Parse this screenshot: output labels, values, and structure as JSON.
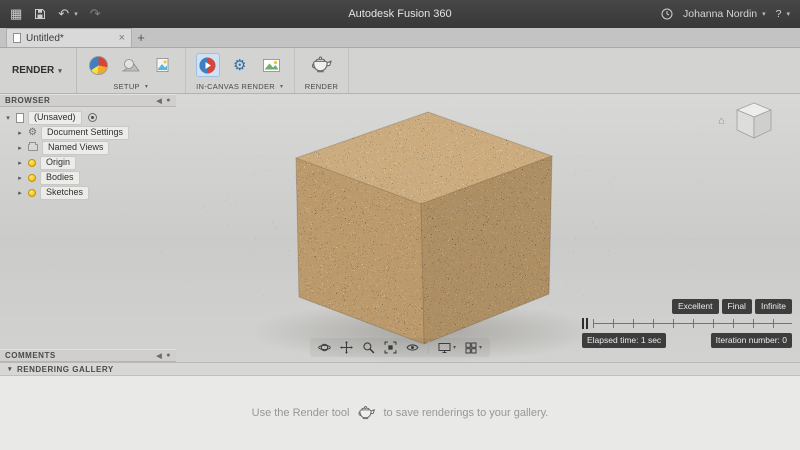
{
  "titlebar": {
    "title": "Autodesk Fusion 360",
    "user": "Johanna Nordin",
    "help": "?"
  },
  "tabbar": {
    "active_tab": "Untitled*"
  },
  "toolbar": {
    "workspace": "RENDER",
    "setup_label": "SETUP",
    "incanvas_label": "IN-CANVAS RENDER",
    "render_label": "RENDER"
  },
  "browser": {
    "title": "BROWSER",
    "root": "(Unsaved)",
    "items": [
      {
        "icon": "gear-icon",
        "label": "Document Settings"
      },
      {
        "icon": "folder-icon",
        "label": "Named Views"
      },
      {
        "icon": "lightbulb-icon",
        "label": "Origin"
      },
      {
        "icon": "lightbulb-icon",
        "label": "Bodies"
      },
      {
        "icon": "lightbulb-icon",
        "label": "Sketches"
      }
    ]
  },
  "comments": {
    "title": "COMMENTS"
  },
  "gallery": {
    "title": "RENDERING GALLERY",
    "caption_prefix": "Use the Render tool",
    "caption_suffix": "to save renderings to your gallery."
  },
  "quality": {
    "presets": [
      "Excellent",
      "Final",
      "Infinite"
    ],
    "elapsed": "Elapsed time: 1 sec",
    "iteration": "Iteration number: 0"
  },
  "icons": {
    "caret_down": "▾",
    "tri_collapsed": "▸",
    "tri_expanded": "▾",
    "close": "×",
    "plus": "+",
    "undo": "↶",
    "redo": "↷",
    "app_grid": "▦",
    "dot": "●",
    "collapse_left": "◀",
    "home": "⌂",
    "gear": "⚙"
  },
  "colors": {
    "badge_bg": "#3d3d3d",
    "cube_base": "#c7a371",
    "accent_blue": "#2e6da4",
    "bulb_yellow": "#f3c313"
  }
}
